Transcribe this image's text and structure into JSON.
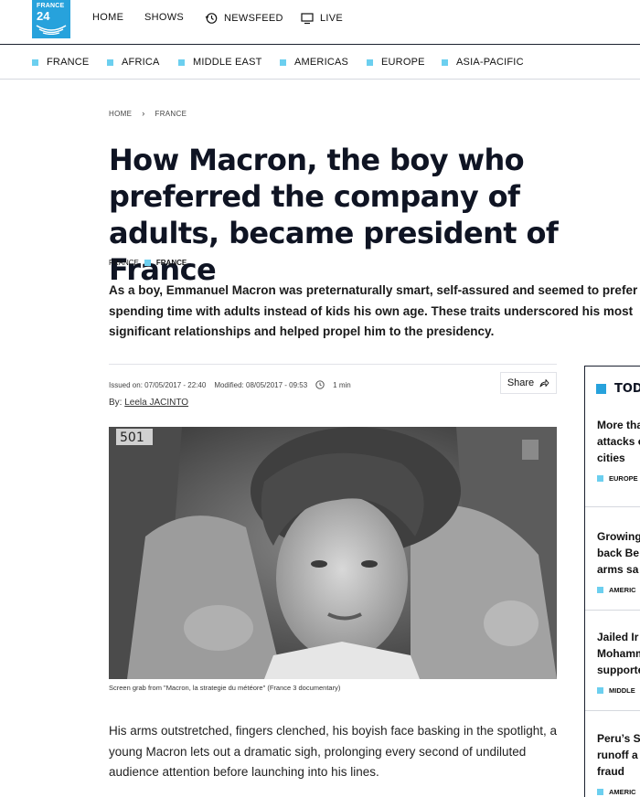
{
  "brand": {
    "line1": "FRANCE",
    "line2": "24",
    "color": "#27a2dc"
  },
  "top_nav": [
    {
      "label": "HOME",
      "icon": ""
    },
    {
      "label": "SHOWS",
      "icon": ""
    },
    {
      "label": "NEWSFEED",
      "icon": "history-clock-icon"
    },
    {
      "label": "LIVE",
      "icon": "tv-screen-icon"
    }
  ],
  "sections": [
    "FRANCE",
    "AFRICA",
    "MIDDLE EAST",
    "AMERICAS",
    "EUROPE",
    "ASIA-PACIFIC"
  ],
  "breadcrumb": {
    "home": "HOME",
    "current": "FRANCE"
  },
  "article": {
    "title": "How Macron, the boy who preferred the company of adults, became president of France",
    "tags": [
      "FRANCE",
      "FRANCE"
    ],
    "lead": "As a boy, Emmanuel Macron was preternaturally smart, self-assured and seemed to prefer spending time with adults instead of kids his own age. These traits underscored his most significant relationships and helped propel him to the presidency.",
    "issued": "Issued on: 07/05/2017 - 22:40",
    "modified": "Modified: 08/05/2017 - 09:53",
    "read_time": "1 min",
    "share_label": "Share",
    "byline_prefix": "By:",
    "author": "Leela JACINTO",
    "photo_caption": "Screen grab from \"Macron, la strategie du météore\" (France 3 documentary)",
    "body": "His arms outstretched, fingers clenched, his boyish face basking in the spotlight, a young Macron lets out a dramatic sigh, prolonging every second of undiluted audience attention before launching into his lines."
  },
  "sidebar": {
    "heading": "TOD",
    "items": [
      {
        "lines": [
          "More tha",
          "attacks o",
          "cities"
        ],
        "tag": "EUROPE"
      },
      {
        "lines": [
          "Growing",
          "back Be",
          "arms sa"
        ],
        "tag": "AMERIC"
      },
      {
        "lines": [
          "Jailed Ir",
          "Mohamm",
          "supporte"
        ],
        "tag": "MIDDLE"
      },
      {
        "lines": [
          "Peru’s S",
          "runoff a",
          "fraud"
        ],
        "tag": "AMERIC"
      }
    ]
  },
  "colors": {
    "accent_square": "#6ccfef",
    "dark": "#0f1423"
  }
}
